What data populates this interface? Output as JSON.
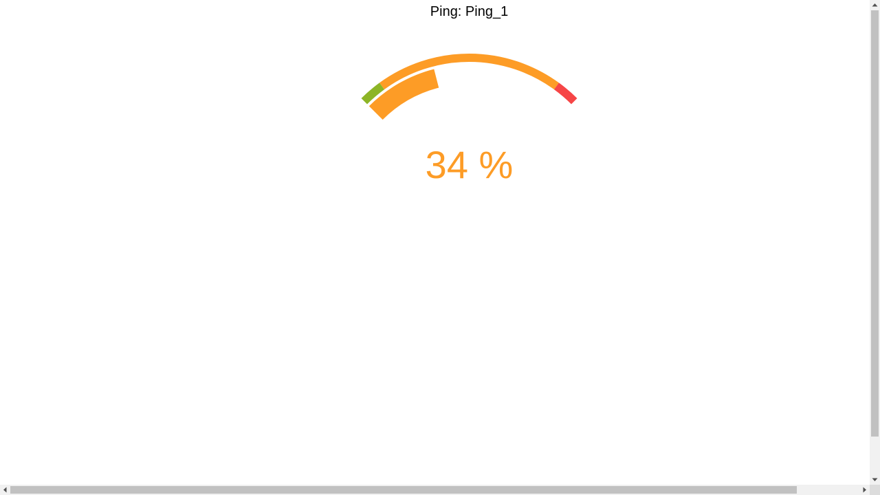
{
  "gauge": {
    "title": "Ping: Ping_1",
    "value": 34,
    "unit": "%",
    "display_text": "34 %",
    "min": 0,
    "max": 100,
    "bands": [
      {
        "from": 0,
        "to": 10,
        "color": "#8db526"
      },
      {
        "from": 10,
        "to": 90,
        "color": "#fd9c26"
      },
      {
        "from": 90,
        "to": 100,
        "color": "#f64546"
      }
    ],
    "value_color": "#fd9c26"
  },
  "colors": {
    "title_text": "#000000",
    "scrollbar_track": "#f1f1f1",
    "scrollbar_thumb": "#c1c1c1",
    "scrollbar_arrow": "#505050"
  },
  "icons": {
    "scroll_up": "triangle-up-icon",
    "scroll_down": "triangle-down-icon",
    "scroll_left": "triangle-left-icon",
    "scroll_right": "triangle-right-icon"
  }
}
